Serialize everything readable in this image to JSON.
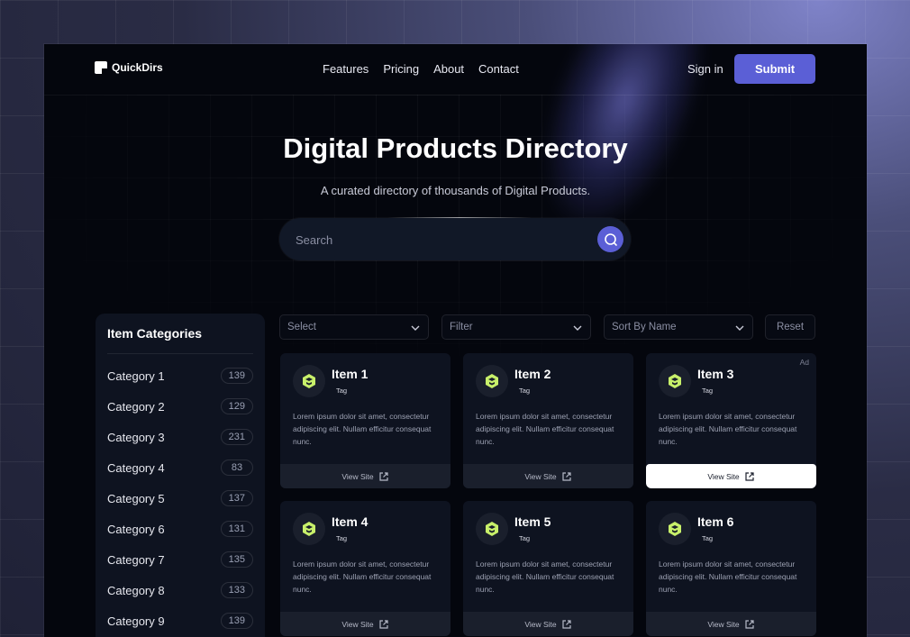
{
  "nav": {
    "logo_text": "QuickDirs",
    "links": [
      "Features",
      "Pricing",
      "About",
      "Contact"
    ],
    "sign_in": "Sign in",
    "submit": "Submit"
  },
  "hero": {
    "title": "Digital Products Directory",
    "subtitle": "A curated directory of thousands of Digital Products.",
    "search_placeholder": "Search"
  },
  "sidebar": {
    "title": "Item Categories",
    "categories": [
      {
        "label": "Category 1",
        "count": "139"
      },
      {
        "label": "Category 2",
        "count": "129"
      },
      {
        "label": "Category 3",
        "count": "231"
      },
      {
        "label": "Category 4",
        "count": "83"
      },
      {
        "label": "Category 5",
        "count": "137"
      },
      {
        "label": "Category 6",
        "count": "131"
      },
      {
        "label": "Category 7",
        "count": "135"
      },
      {
        "label": "Category 8",
        "count": "133"
      },
      {
        "label": "Category 9",
        "count": "139"
      }
    ]
  },
  "filters": {
    "select": "Select",
    "filter": "Filter",
    "sort": "Sort By Name",
    "reset": "Reset"
  },
  "items": [
    {
      "title": "Item 1",
      "tag": "Tag",
      "desc": "Lorem ipsum dolor sit amet, consectetur adipiscing elit. Nullam efficitur consequat nunc.",
      "cta": "View Site",
      "ad": ""
    },
    {
      "title": "Item 2",
      "tag": "Tag",
      "desc": "Lorem ipsum dolor sit amet, consectetur adipiscing elit. Nullam efficitur consequat nunc.",
      "cta": "View Site",
      "ad": ""
    },
    {
      "title": "Item 3",
      "tag": "Tag",
      "desc": "Lorem ipsum dolor sit amet, consectetur adipiscing elit. Nullam efficitur consequat nunc.",
      "cta": "View Site",
      "ad": "Ad"
    },
    {
      "title": "Item 4",
      "tag": "Tag",
      "desc": "Lorem ipsum dolor sit amet, consectetur adipiscing elit. Nullam efficitur consequat nunc.",
      "cta": "View Site",
      "ad": ""
    },
    {
      "title": "Item 5",
      "tag": "Tag",
      "desc": "Lorem ipsum dolor sit amet, consectetur adipiscing elit. Nullam efficitur consequat nunc.",
      "cta": "View Site",
      "ad": ""
    },
    {
      "title": "Item 6",
      "tag": "Tag",
      "desc": "Lorem ipsum dolor sit amet, consectetur adipiscing elit. Nullam efficitur consequat nunc.",
      "cta": "View Site",
      "ad": ""
    }
  ],
  "colors": {
    "accent": "#5b5fd6",
    "product_icon": "#c8f06a"
  }
}
